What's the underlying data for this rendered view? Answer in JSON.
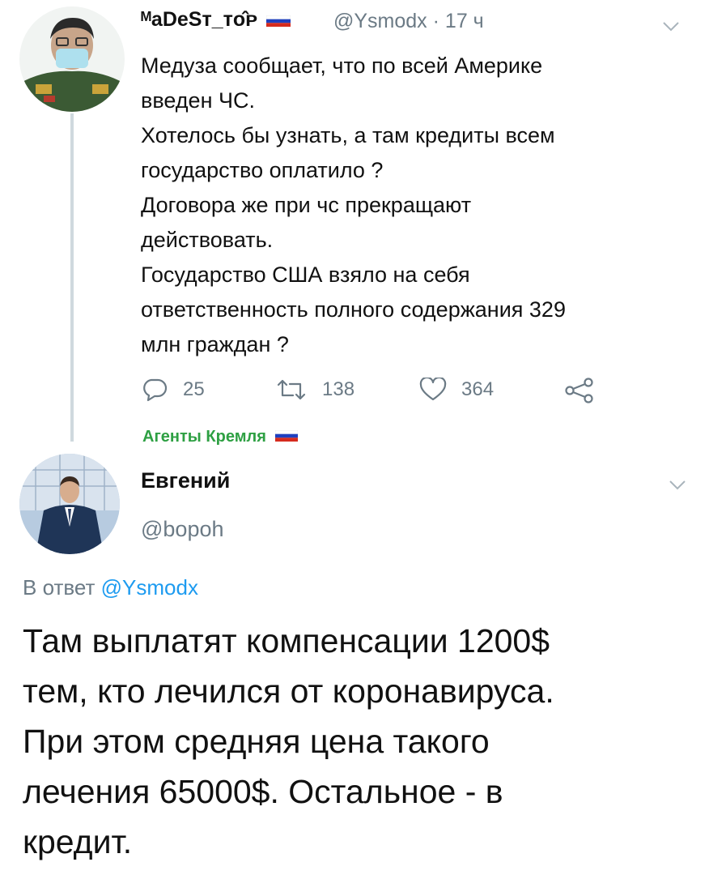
{
  "tweet1": {
    "display_name": "ᴹaDeSт_ᴛᴏ̂ᴘ",
    "handle": "@Ysmodx",
    "time": "17 ч",
    "lines": [
      "Медуза сообщает, что по всей Америке",
      "введен ЧС.",
      "Хотелось бы узнать, а там кредиты всем",
      "государство оплатило ?",
      "Договора же при чс прекращают",
      "действовать.",
      "Государство США взяло на себя",
      "ответственность полного содержания 329",
      "млн граждан ?"
    ],
    "actions": {
      "replies": "25",
      "retweets": "138",
      "likes": "364"
    },
    "icons": [
      "reply-icon",
      "retweet-icon",
      "like-icon",
      "share-icon",
      "chevron-down-icon"
    ]
  },
  "separator_tag": "Агенты Кремля",
  "tweet2": {
    "display_name": "Евгений",
    "handle": "@bopoh",
    "reply_prefix": "В ответ",
    "reply_handle": "@Ysmodx",
    "lines": [
      "Там выплатят компенсации 1200$",
      "тем, кто лечился от коронавируса.",
      "При этом средняя цена такого",
      "лечения 65000$. Остальное - в",
      "кредит."
    ]
  },
  "colors": {
    "accent": "#1d9bf0",
    "muted": "#6b7a85",
    "tag_green": "#2ea043",
    "flag": [
      "#ffffff",
      "#1e3fbf",
      "#d52b1e"
    ]
  }
}
